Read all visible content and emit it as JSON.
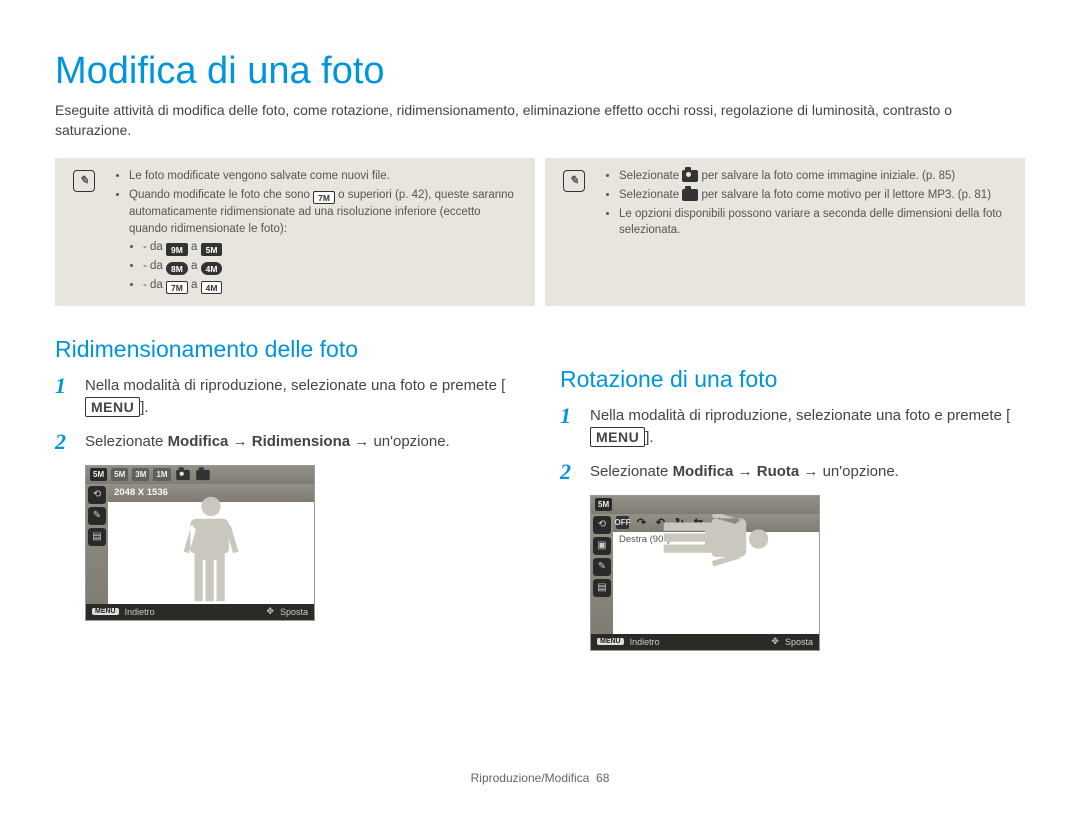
{
  "title": "Modifica di una foto",
  "intro": "Eseguite attività di modifica delle foto, come rotazione, ridimensionamento, eliminazione effetto occhi rossi, regolazione di luminosità, contrasto o saturazione.",
  "note_left": {
    "item1": "Le foto modificate vengono salvate come nuovi file.",
    "item2a": "Quando modificate le foto che sono ",
    "item2b": " o superiori (p. 42), queste saranno automaticamente ridimensionate ad una risoluzione inferiore (eccetto quando ridimensionate le foto):",
    "dash_prefix": "da ",
    "dash_mid": " a ",
    "d1a": "9M",
    "d1b": "5M",
    "d2a": "8M",
    "d2b": "4M",
    "d3a": "7M",
    "d3b": "4M",
    "sup_chip": "7M"
  },
  "note_right": {
    "item1a": "Selezionate ",
    "item1b": " per salvare la foto come immagine iniziale. (p. 85)",
    "item2a": "Selezionate ",
    "item2b": " per salvare la foto come motivo per il lettore MP3. (p. 81)",
    "item3": "Le opzioni disponibili possono variare a seconda delle dimensioni della foto selezionata."
  },
  "sectionA": {
    "title": "Ridimensionamento delle foto",
    "step1": "Nella modalità di riproduzione, selezionate una foto e premete [",
    "step1b": "].",
    "step2a": "Selezionate ",
    "step2b": "Modifica",
    "step2c": " → ",
    "step2d": "Ridimensiona",
    "step2e": " → un'opzione.",
    "menu_label": "MENU",
    "cam_label": "2048 X 1536",
    "cam_back": "Indietro",
    "cam_move": "Sposta",
    "cam_back_chip": "MENU",
    "chips": [
      "5M",
      "5M",
      "3M",
      "1M"
    ]
  },
  "sectionB": {
    "title": "Rotazione di una foto",
    "step1": "Nella modalità di riproduzione, selezionate una foto e premete [",
    "step1b": "].",
    "step2a": "Selezionate ",
    "step2b": "Modifica",
    "step2c": " → ",
    "step2d": "Ruota",
    "step2e": " → un'opzione.",
    "menu_label": "MENU",
    "cam_label": "Destra (90°)",
    "cam_back": "Indietro",
    "cam_move": "Sposta",
    "cam_back_chip": "MENU",
    "top_chip": "5M"
  },
  "footer_section": "Riproduzione/Modifica",
  "footer_page": "68"
}
